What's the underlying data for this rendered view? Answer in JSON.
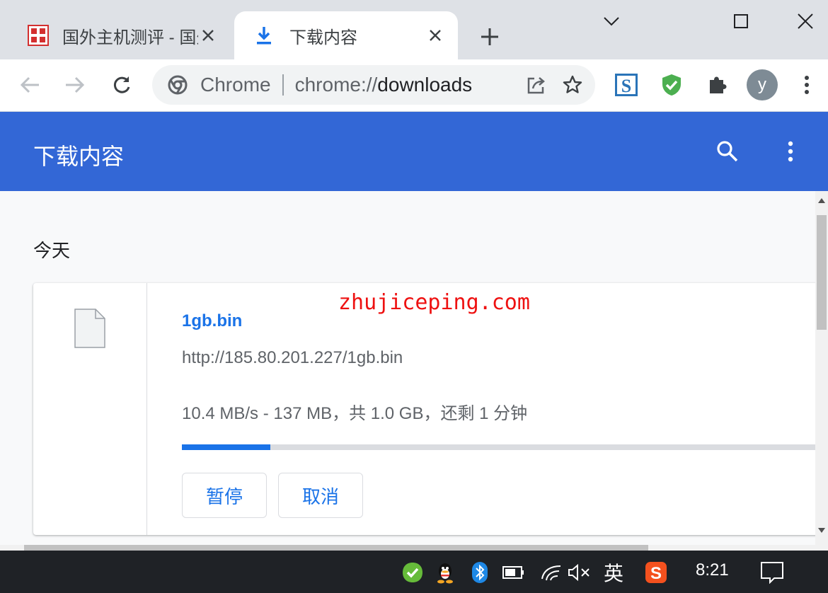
{
  "tabs": [
    {
      "title": "国外主机测评 - 国外VPS",
      "active": false,
      "icon": "site-favicon-icon"
    },
    {
      "title": "下载内容",
      "active": true,
      "icon": "download-icon"
    }
  ],
  "omnibox": {
    "chip": "Chrome",
    "url_scheme": "chrome://",
    "url_host": "downloads"
  },
  "avatar": {
    "letter": "y",
    "color": "#7e8b95"
  },
  "header": {
    "title": "下载内容",
    "color": "#3367d6"
  },
  "section": {
    "date": "今天"
  },
  "download": {
    "file_name": "1gb.bin",
    "url": "http://185.80.201.227/1gb.bin",
    "status": "10.4 MB/s - 137 MB，共 1.0 GB，还剩 1 分钟",
    "progress": 0.137,
    "pause_label": "暂停",
    "cancel_label": "取消"
  },
  "watermark": "zhujiceping.com",
  "taskbar": {
    "ime": "英",
    "time": "8:21"
  },
  "colors": {
    "accent": "#1a73e8",
    "watermark": "#ee1111"
  }
}
